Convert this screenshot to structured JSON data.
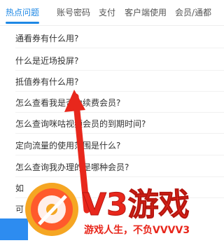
{
  "tabs": [
    {
      "label": "热点问题",
      "active": true
    },
    {
      "label": "账号密码",
      "active": false
    },
    {
      "label": "支付",
      "active": false
    },
    {
      "label": "客户端使用",
      "active": false
    },
    {
      "label": "会员/通都",
      "active": false
    }
  ],
  "faq": [
    "通看券有什么用?",
    "什么是近场投屏?",
    "抵值券有什么用?",
    "怎么查看我是否为续费会员?",
    "怎么查询咪咕视频会员的到期时间?",
    "定向流量的使用范围是什么?",
    "怎么查询我办理的是哪种会员?",
    "如",
    "可"
  ],
  "watermark": {
    "brand": "V3游戏",
    "slogan": "游戏人生，不负VVVV3"
  },
  "colors": {
    "accent": "#1e88e5",
    "arrow": "#e8271c",
    "logo_orange": "#f5a623",
    "logo_red": "#e8271c"
  }
}
